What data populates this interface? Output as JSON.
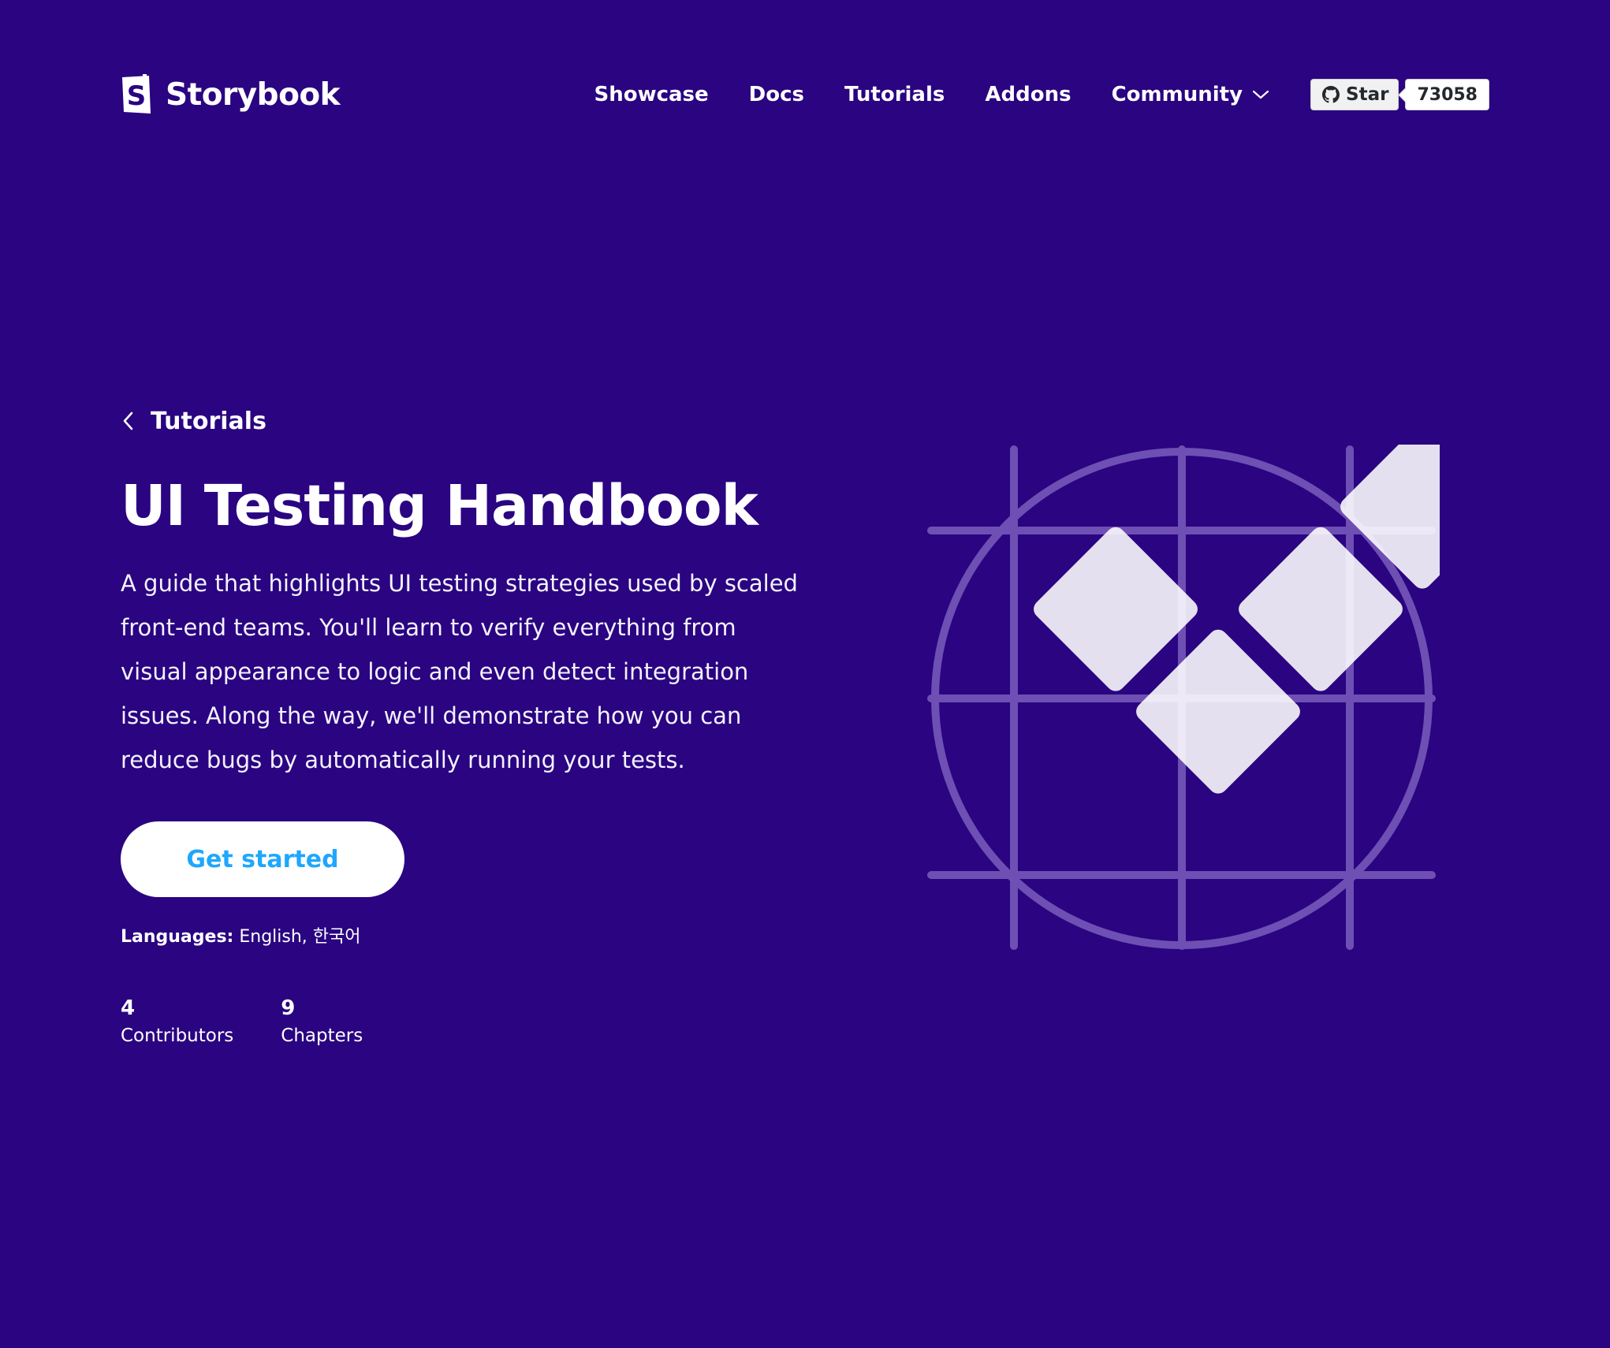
{
  "brand": {
    "name": "Storybook",
    "logo_icon": "storybook-logo-icon"
  },
  "nav": {
    "items": [
      {
        "label": "Showcase"
      },
      {
        "label": "Docs"
      },
      {
        "label": "Tutorials"
      },
      {
        "label": "Addons"
      },
      {
        "label": "Community",
        "icon": "chevron-down-icon"
      }
    ],
    "github": {
      "star_label": "Star",
      "star_count": "73058",
      "icon": "github-icon"
    }
  },
  "hero": {
    "back_label": "Tutorials",
    "title": "UI Testing Handbook",
    "description": "A guide that highlights UI testing strategies used by scaled front-end teams. You'll learn to verify everything from visual appearance to logic and even detect integration issues. Along the way, we'll demonstrate how you can reduce bugs by automatically running your tests.",
    "cta_label": "Get started",
    "languages_label": "Languages:",
    "languages_value": "English, 한국어",
    "stats": [
      {
        "value": "4",
        "label": "Contributors"
      },
      {
        "value": "9",
        "label": "Chapters"
      }
    ],
    "illustration_icon": "checkmark-grid-illustration"
  },
  "colors": {
    "background": "#2a0481",
    "accent": "#1ea7fd",
    "illustration_lines": "#6e4fb3",
    "illustration_tiles": "#e8e6f3"
  }
}
